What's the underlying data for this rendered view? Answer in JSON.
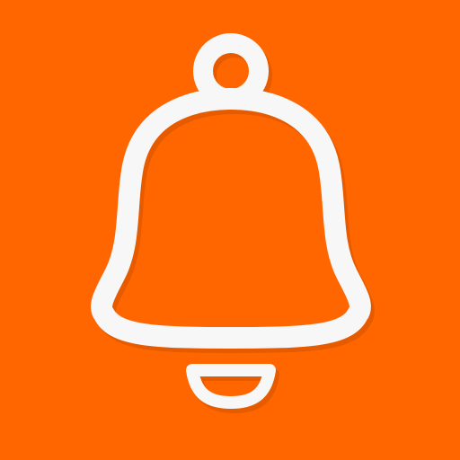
{
  "app_icon": {
    "icon_name": "bell-icon",
    "background_color": "#FF6600",
    "glyph_color": "#F7F7F8",
    "shadow_color": "#B84800"
  }
}
